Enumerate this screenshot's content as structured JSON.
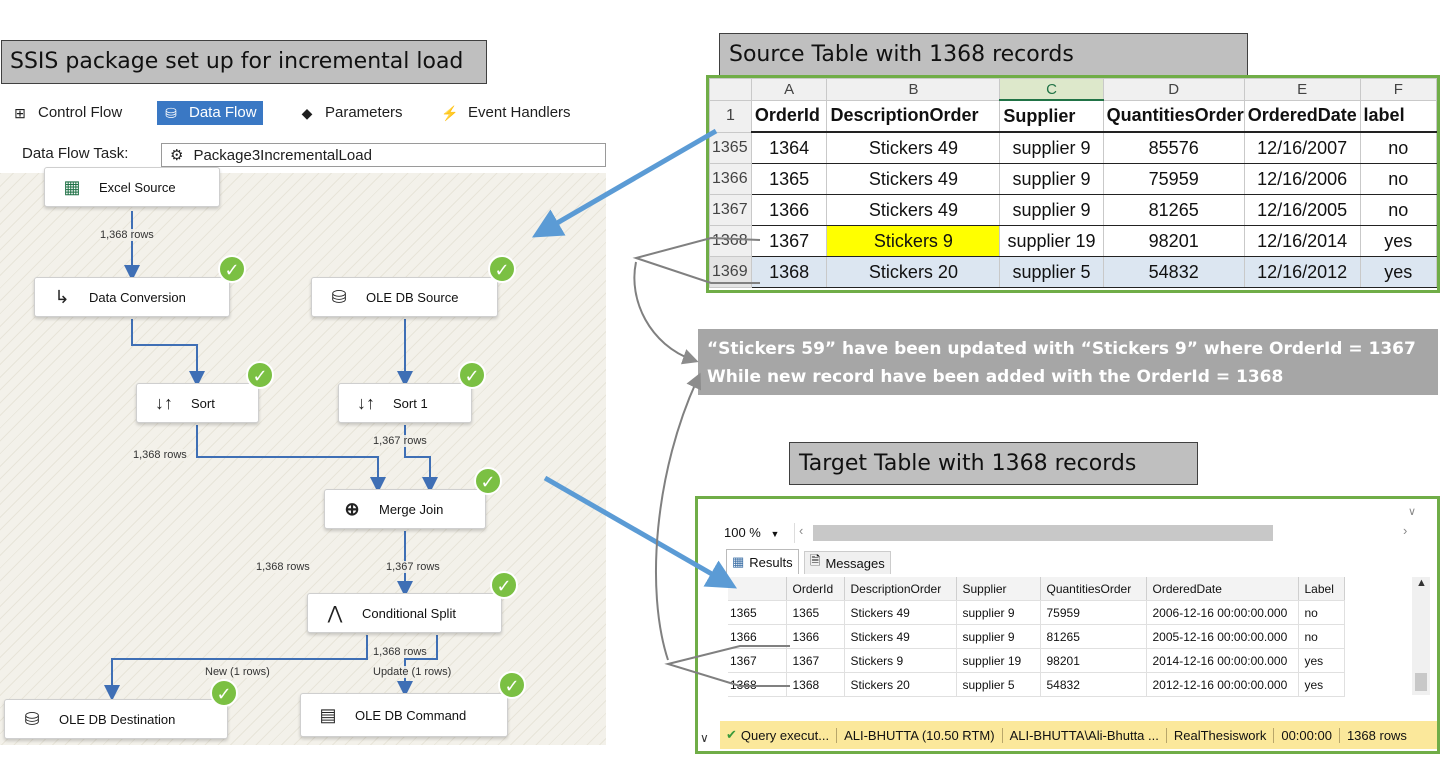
{
  "ssis_title": "SSIS package set up for incremental load",
  "tabs": [
    {
      "label": "Control Flow",
      "icon": "control-flow-icon"
    },
    {
      "label": "Data Flow",
      "icon": "data-flow-icon"
    },
    {
      "label": "Parameters",
      "icon": "parameters-icon"
    },
    {
      "label": "Event Handlers",
      "icon": "event-handlers-icon"
    }
  ],
  "dft_label": "Data Flow Task:",
  "dft_value": "Package3IncrementalLoad",
  "nodes": {
    "excel_source": "Excel Source",
    "data_conversion": "Data Conversion",
    "oledb_source": "OLE DB Source",
    "sort": "Sort",
    "sort1": "Sort 1",
    "merge_join": "Merge Join",
    "conditional_split": "Conditional Split",
    "oledb_destination": "OLE DB Destination",
    "oledb_command": "OLE DB Command"
  },
  "row_labels": {
    "excel_to_conv": "1,368 rows",
    "conv_to_sort": "1,368 rows",
    "src_to_sort1": "1,367 rows",
    "sort_to_merge": "1,368 rows",
    "sort1_to_merge": "1,367 rows",
    "merge_to_split": "1,368 rows",
    "new_path": "New (1 rows)",
    "update_path": "Update (1 rows)"
  },
  "source_title": "Source Table with 1368 records",
  "excel": {
    "col_letters": [
      "A",
      "B",
      "C",
      "D",
      "E",
      "F"
    ],
    "header_row_num": "1",
    "headers": [
      "OrderId",
      "DescriptionOrder",
      "Supplier",
      "QuantitiesOrder",
      "OrderedDate",
      "label"
    ],
    "rows": [
      {
        "rn": "1365",
        "cells": [
          "1364",
          "Stickers 49",
          "supplier 9",
          "85576",
          "12/16/2007",
          "no"
        ]
      },
      {
        "rn": "1366",
        "cells": [
          "1365",
          "Stickers 49",
          "supplier 9",
          "75959",
          "12/16/2006",
          "no"
        ]
      },
      {
        "rn": "1367",
        "cells": [
          "1366",
          "Stickers 49",
          "supplier 9",
          "81265",
          "12/16/2005",
          "no"
        ]
      },
      {
        "rn": "1368",
        "cells": [
          "1367",
          "Stickers 9",
          "supplier 19",
          "98201",
          "12/16/2014",
          "yes"
        ]
      },
      {
        "rn": "1369",
        "cells": [
          "1368",
          "Stickers 20",
          "supplier 5",
          "54832",
          "12/16/2012",
          "yes"
        ]
      }
    ]
  },
  "note": {
    "line1": "“Stickers 59” have been updated with “Stickers 9” where OrderId = 1367",
    "line2": "While new record have been added with the OrderId = 1368"
  },
  "target_title": "Target Table with 1368 records",
  "ssms": {
    "zoom": "100 %",
    "tab_results": "Results",
    "tab_messages": "Messages",
    "headers": [
      "OrderId",
      "DescriptionOrder",
      "Supplier",
      "QuantitiesOrder",
      "OrderedDate",
      "Label"
    ],
    "rows": [
      {
        "rn": "1365",
        "cells": [
          "1365",
          "Stickers 49",
          "supplier 9",
          "75959",
          "2006-12-16 00:00:00.000",
          "no"
        ]
      },
      {
        "rn": "1366",
        "cells": [
          "1366",
          "Stickers 49",
          "supplier 9",
          "81265",
          "2005-12-16 00:00:00.000",
          "no"
        ]
      },
      {
        "rn": "1367",
        "cells": [
          "1367",
          "Stickers 9",
          "supplier 19",
          "98201",
          "2014-12-16 00:00:00.000",
          "yes"
        ]
      },
      {
        "rn": "1368",
        "cells": [
          "1368",
          "Stickers 20",
          "supplier 5",
          "54832",
          "2012-12-16 00:00:00.000",
          "yes"
        ]
      }
    ],
    "status": [
      "Query execut...",
      "ALI-BHUTTA (10.50 RTM)",
      "ALI-BHUTTA\\Ali-Bhutta ...",
      "RealThesiswork",
      "00:00:00",
      "1368 rows"
    ]
  },
  "colors": {
    "accent": "#3a78c4",
    "green_border": "#70ad47",
    "check": "#7bc043",
    "arrow": "#5b9bd5",
    "highlight": "#ffff00"
  }
}
